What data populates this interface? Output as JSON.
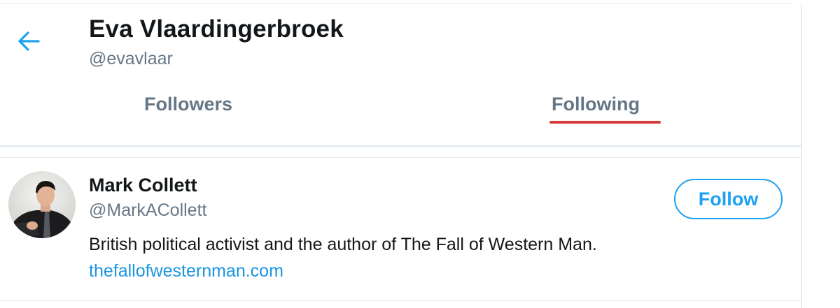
{
  "header": {
    "back_icon": "arrow-left-icon",
    "name": "Eva Vlaardingerbroek",
    "handle": "@evavlaar"
  },
  "tabs": [
    {
      "label": "Followers",
      "selected": false
    },
    {
      "label": "Following",
      "selected": true
    }
  ],
  "users": [
    {
      "name": "Mark Collett",
      "handle": "@MarkACollett",
      "bio": "British political activist and the author of The Fall of Western Man.",
      "link": "thefallofwesternman.com",
      "follow_label": "Follow"
    }
  ],
  "colors": {
    "accent": "#1da1f2",
    "link": "#1b95e0",
    "secondary_text": "#657786",
    "primary_text": "#14171a",
    "tab_underline": "#d93a3a",
    "border": "#e6ecf0"
  }
}
